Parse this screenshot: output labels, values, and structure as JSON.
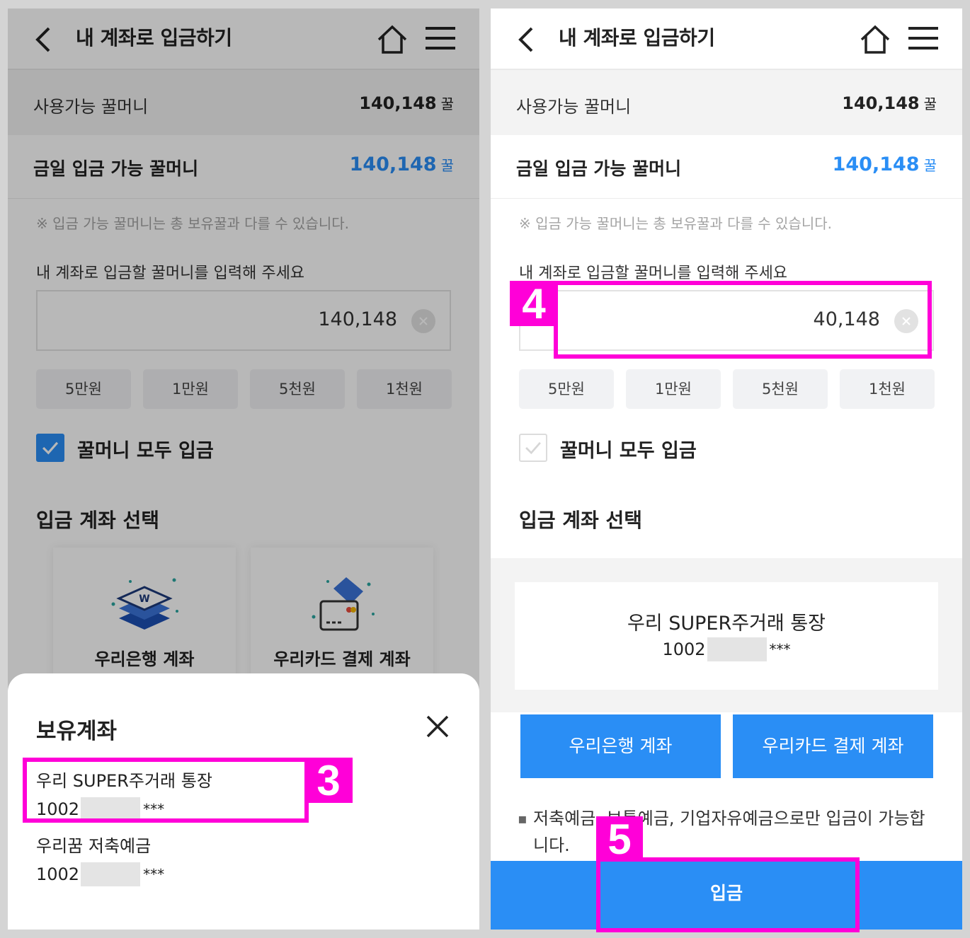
{
  "header": {
    "title": "내 계좌로 입금하기"
  },
  "balance": {
    "available_label": "사용가능 꿀머니",
    "available_value": "140,148",
    "unit": "꿀",
    "today_label": "금일 입금 가능 꿀머니",
    "today_value": "140,148"
  },
  "notice": "※ 입금 가능 꿀머니는 총 보유꿀과 다를 수 있습니다.",
  "amount": {
    "prompt": "내 계좌로 입금할 꿀머니를 입력해 주세요",
    "left_value": "140,148",
    "right_value": "40,148"
  },
  "quick_amounts": [
    "5만원",
    "1만원",
    "5천원",
    "1천원"
  ],
  "deposit_all": {
    "label": "꿀머니 모두 입금",
    "left_checked": true,
    "right_checked": false
  },
  "account_select": {
    "title": "입금 계좌 선택",
    "bank_label": "우리은행 계좌",
    "card_label": "우리카드 결제 계좌",
    "bank_icon_mark": "W"
  },
  "sheet": {
    "title": "보유계좌",
    "accounts": [
      {
        "name": "우리 SUPER주거래 통장",
        "prefix": "1002",
        "suffix": "***"
      },
      {
        "name": "우리꿈 저축예금",
        "prefix": "1002",
        "suffix": "***"
      }
    ]
  },
  "selected_account": {
    "name": "우리 SUPER주거래 통장",
    "prefix": "1002",
    "suffix": "***"
  },
  "info": "저축예금, 보통예금, 기업자유예금으로만 입금이 가능합니다.",
  "deposit_button": "입금",
  "steps": {
    "three": "3",
    "four": "4",
    "five": "5"
  },
  "colors": {
    "accent": "#2a8ef5",
    "highlight": "#ff00d8",
    "background": "#d4d4d4"
  }
}
